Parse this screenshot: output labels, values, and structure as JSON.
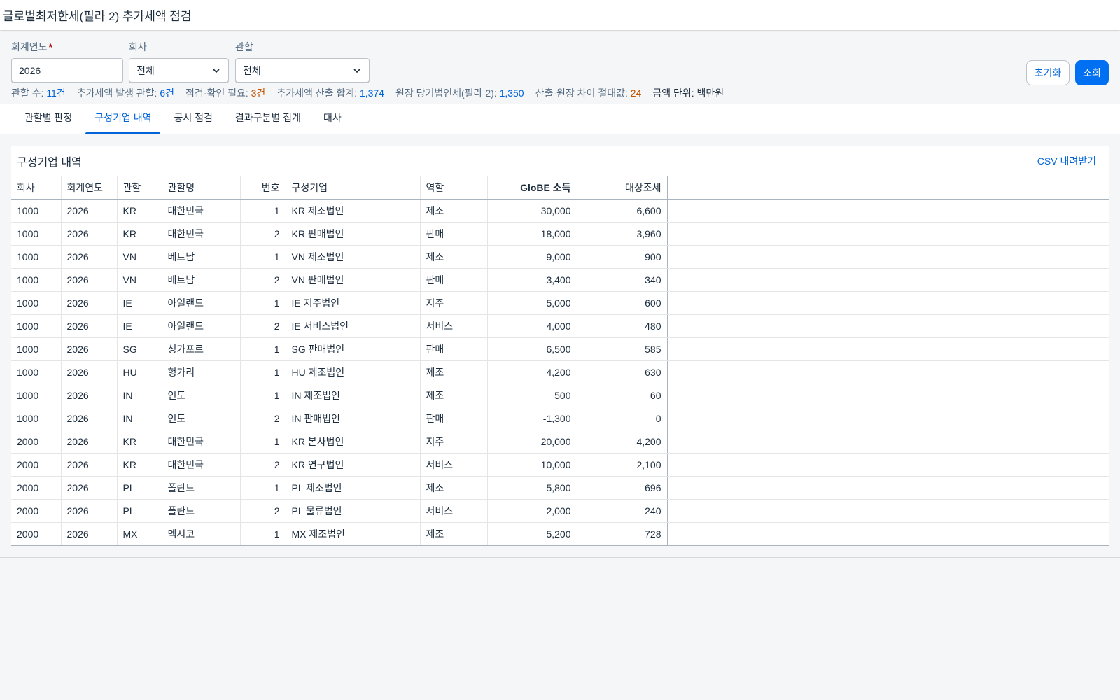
{
  "header": {
    "title": "글로벌최저한세(필라 2) 추가세액 점검"
  },
  "filters": {
    "fiscal_year": {
      "label": "회계연도",
      "required_mark": "*",
      "value": "2026"
    },
    "company": {
      "label": "회사",
      "value": "전체"
    },
    "jurisdiction": {
      "label": "관할",
      "value": "전체"
    }
  },
  "buttons": {
    "reset": "초기화",
    "search": "조회"
  },
  "summary": {
    "jurisdiction_count": {
      "label": "관할 수:",
      "value": "11건"
    },
    "topup_jurisdictions": {
      "label": "추가세액 발생 관할:",
      "value": "6건"
    },
    "needs_review": {
      "label": "점검·확인 필요:",
      "value": "3건"
    },
    "topup_total": {
      "label": "추가세액 산출 합계:",
      "value": "1,374"
    },
    "ledger_tax": {
      "label": "원장 당기법인세(필라 2):",
      "value": "1,350"
    },
    "abs_diff": {
      "label": "산출-원장 차이 절대값:",
      "value": "24"
    },
    "unit": {
      "label": "금액 단위:",
      "value": "백만원"
    }
  },
  "tabs": [
    {
      "label": "관할별 판정"
    },
    {
      "label": "구성기업 내역"
    },
    {
      "label": "공시 점검"
    },
    {
      "label": "결과구분별 집계"
    },
    {
      "label": "대사"
    }
  ],
  "panel": {
    "title": "구성기업 내역",
    "csv": "CSV 내려받기"
  },
  "table": {
    "columns": [
      "회사",
      "회계연도",
      "관할",
      "관할명",
      "번호",
      "구성기업",
      "역할",
      "GloBE 소득",
      "대상조세"
    ],
    "rows": [
      [
        "1000",
        "2026",
        "KR",
        "대한민국",
        "1",
        "KR 제조법인",
        "제조",
        "30,000",
        "6,600"
      ],
      [
        "1000",
        "2026",
        "KR",
        "대한민국",
        "2",
        "KR 판매법인",
        "판매",
        "18,000",
        "3,960"
      ],
      [
        "1000",
        "2026",
        "VN",
        "베트남",
        "1",
        "VN 제조법인",
        "제조",
        "9,000",
        "900"
      ],
      [
        "1000",
        "2026",
        "VN",
        "베트남",
        "2",
        "VN 판매법인",
        "판매",
        "3,400",
        "340"
      ],
      [
        "1000",
        "2026",
        "IE",
        "아일랜드",
        "1",
        "IE 지주법인",
        "지주",
        "5,000",
        "600"
      ],
      [
        "1000",
        "2026",
        "IE",
        "아일랜드",
        "2",
        "IE 서비스법인",
        "서비스",
        "4,000",
        "480"
      ],
      [
        "1000",
        "2026",
        "SG",
        "싱가포르",
        "1",
        "SG 판매법인",
        "판매",
        "6,500",
        "585"
      ],
      [
        "1000",
        "2026",
        "HU",
        "헝가리",
        "1",
        "HU 제조법인",
        "제조",
        "4,200",
        "630"
      ],
      [
        "1000",
        "2026",
        "IN",
        "인도",
        "1",
        "IN 제조법인",
        "제조",
        "500",
        "60"
      ],
      [
        "1000",
        "2026",
        "IN",
        "인도",
        "2",
        "IN 판매법인",
        "판매",
        "-1,300",
        "0"
      ],
      [
        "2000",
        "2026",
        "KR",
        "대한민국",
        "1",
        "KR 본사법인",
        "지주",
        "20,000",
        "4,200"
      ],
      [
        "2000",
        "2026",
        "KR",
        "대한민국",
        "2",
        "KR 연구법인",
        "서비스",
        "10,000",
        "2,100"
      ],
      [
        "2000",
        "2026",
        "PL",
        "폴란드",
        "1",
        "PL 제조법인",
        "제조",
        "5,800",
        "696"
      ],
      [
        "2000",
        "2026",
        "PL",
        "폴란드",
        "2",
        "PL 물류법인",
        "서비스",
        "2,000",
        "240"
      ],
      [
        "2000",
        "2026",
        "MX",
        "멕시코",
        "1",
        "MX 제조법인",
        "제조",
        "5,200",
        "728"
      ]
    ]
  }
}
